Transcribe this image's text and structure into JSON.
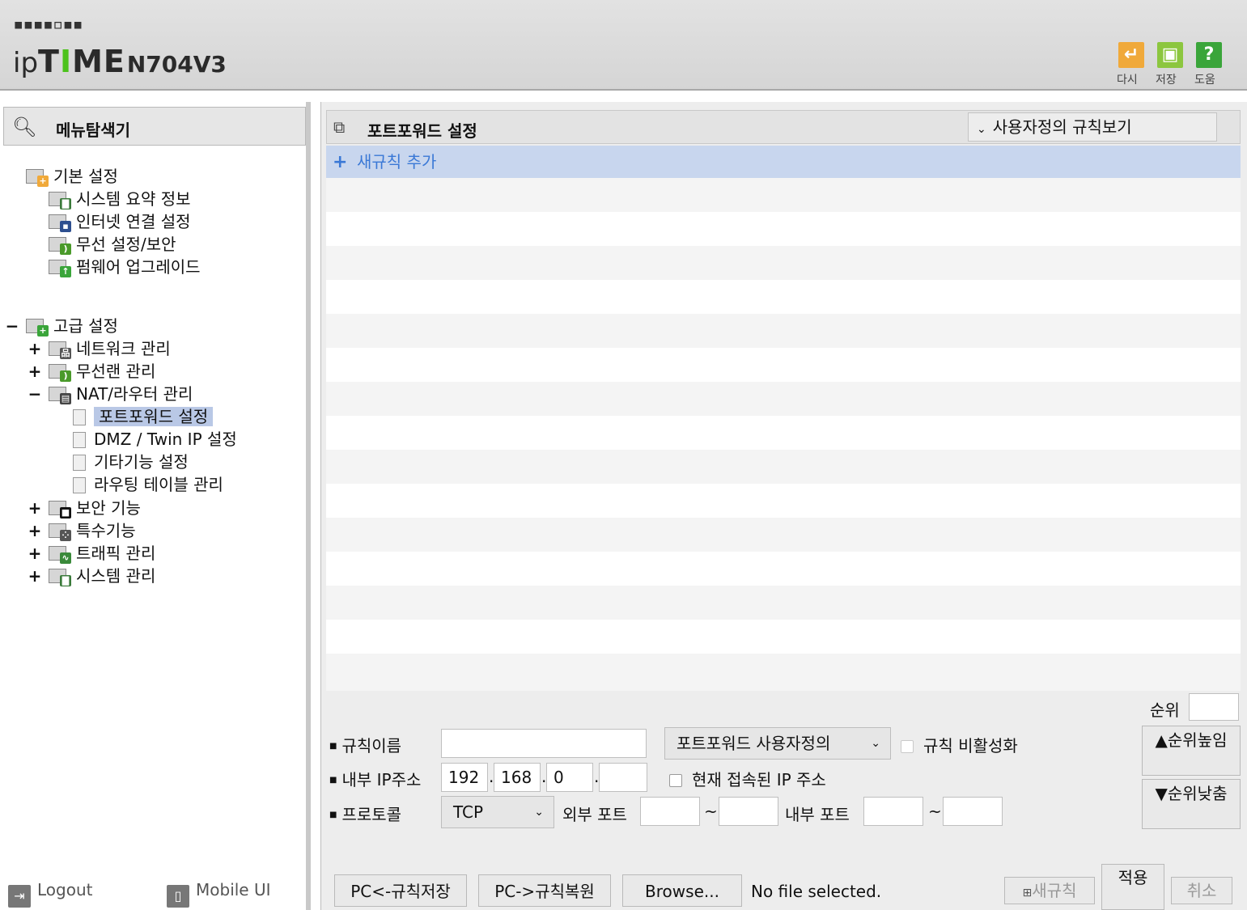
{
  "header": {
    "logo_dots": "▪▪▪▪▫▪▪",
    "logo_ip": "ip",
    "logo_time_a": "T",
    "logo_time_b": "I",
    "logo_time_c": "ME",
    "model": "N704V3",
    "buttons": [
      {
        "label": "다시",
        "icon": "undo-icon",
        "color": "#f0a93a"
      },
      {
        "label": "저장",
        "icon": "save-icon",
        "color": "#8cc63f"
      },
      {
        "label": "도움",
        "icon": "help-icon",
        "color": "#3aa53a"
      }
    ]
  },
  "sidebar": {
    "title": "메뉴탐색기",
    "groups": {
      "basic": {
        "label": "기본 설정",
        "items": [
          "시스템 요약 정보",
          "인터넷 연결 설정",
          "무선 설정/보안",
          "펌웨어 업그레이드"
        ]
      },
      "advanced": {
        "label": "고급 설정",
        "items": [
          "네트워크 관리",
          "무선랜 관리",
          "NAT/라우터 관리",
          "보안 기능",
          "특수기능",
          "트래픽 관리",
          "시스템 관리"
        ],
        "nat_children": [
          "포트포워드 설정",
          "DMZ / Twin IP 설정",
          "기타기능 설정",
          "라우팅 테이블 관리"
        ]
      }
    },
    "footer": {
      "logout": "Logout",
      "mobile": "Mobile UI"
    }
  },
  "main": {
    "title": "포트포워드 설정",
    "view_select": "사용자정의 규칙보기",
    "add_rule": "새규칙 추가",
    "form": {
      "rank_label": "순위",
      "rank_value": "",
      "rule_name_label": "규칙이름",
      "rule_name_value": "",
      "rule_type_select": "포트포워드 사용자정의",
      "disable_rule_label": "규칙 비활성화",
      "internal_ip_label": "내부 IP주소",
      "ip": [
        "192",
        "168",
        "0",
        ""
      ],
      "current_ip_label": "현재 접속된 IP 주소",
      "protocol_label": "프로토콜",
      "protocol_value": "TCP",
      "external_port_label": "외부 포트",
      "internal_port_label": "내부 포트",
      "tilde": "~",
      "rank_up": "▲순위높임",
      "rank_down": "▼순위낮춤"
    },
    "bottom": {
      "save_rules": "PC<-규칙저장",
      "restore_rules": "PC->규칙복원",
      "browse": "Browse...",
      "file_status": "No file selected.",
      "new_rule": "새규칙",
      "apply": "적용",
      "cancel": "취소"
    }
  }
}
